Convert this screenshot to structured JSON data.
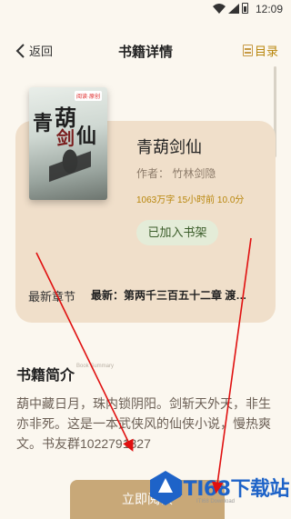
{
  "status_bar": {
    "time": "12:09"
  },
  "header": {
    "back_label": "返回",
    "title": "书籍详情",
    "toc_label": "目录"
  },
  "book": {
    "title": "青葫剑仙",
    "author": "作者：  竹林剑隐",
    "meta": "1063万字  15小时前  10.0分",
    "shelf_button": "已加入书架",
    "cover": {
      "badge": "阅读·原创",
      "title_chars": [
        "青",
        "葫",
        "剑",
        "仙"
      ]
    }
  },
  "latest": {
    "label": "最新章节",
    "text": "最新：第两千三百五十二章  渡劫..."
  },
  "intro": {
    "title": "书籍简介",
    "subtitle": "Book Summary",
    "body": "葫中藏日月，珠内锁阴阳。剑斩天外天，非生亦非死。这是一本武侠风的仙侠小说，慢热爽文。书友群1022791327"
  },
  "read_button": "立即阅读",
  "watermark": {
    "text": "ITI68下载站",
    "sub": "ITI68 Download"
  },
  "colors": {
    "accent": "#c8a878",
    "card": "#f0dfca",
    "arrow": "#e01010",
    "watermark": "#1e63c8"
  }
}
